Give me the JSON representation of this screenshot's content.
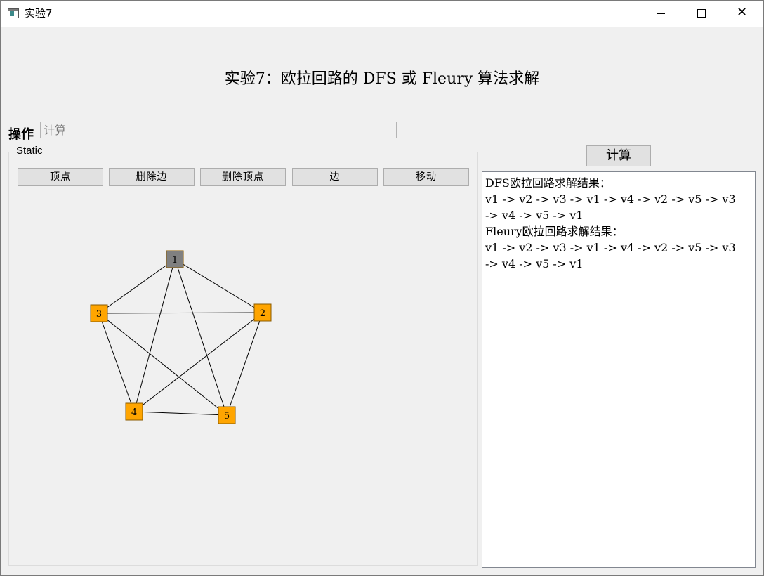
{
  "window": {
    "title": "实验7",
    "min_glyph": "",
    "close_glyph": "✕"
  },
  "heading": "实验7：欧拉回路的 DFS 或 Fleury 算法求解",
  "operation": {
    "label": "操作",
    "placeholder": "计算",
    "value": ""
  },
  "group": {
    "label": "Static"
  },
  "toolbar": {
    "buttons": [
      "顶点",
      "删除边",
      "删除顶点",
      "边",
      "移动"
    ]
  },
  "graph": {
    "vertices": [
      {
        "id": "1",
        "label": "1",
        "state": "selected",
        "color": "#808080"
      },
      {
        "id": "2",
        "label": "2",
        "state": "normal",
        "color": "#ffa500"
      },
      {
        "id": "3",
        "label": "3",
        "state": "normal",
        "color": "#ffa500"
      },
      {
        "id": "4",
        "label": "4",
        "state": "normal",
        "color": "#ffa500"
      },
      {
        "id": "5",
        "label": "5",
        "state": "normal",
        "color": "#ffa500"
      }
    ],
    "edges": [
      [
        "1",
        "2"
      ],
      [
        "1",
        "3"
      ],
      [
        "1",
        "4"
      ],
      [
        "1",
        "5"
      ],
      [
        "2",
        "3"
      ],
      [
        "2",
        "4"
      ],
      [
        "2",
        "5"
      ],
      [
        "3",
        "4"
      ],
      [
        "3",
        "5"
      ],
      [
        "4",
        "5"
      ]
    ]
  },
  "calc_button": "计算",
  "output_lines": [
    "DFS欧拉回路求解结果：",
    "v1 -> v2 -> v3 -> v1 -> v4 -> v2 -> v5 -> v3",
    "-> v4 -> v5 -> v1",
    "Fleury欧拉回路求解结果：",
    "v1 -> v2 -> v3 -> v1 -> v4 -> v2 -> v5 -> v3",
    "-> v4 -> v5 -> v1"
  ]
}
